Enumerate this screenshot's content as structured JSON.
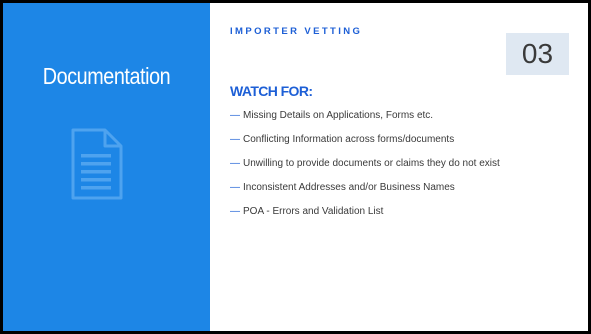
{
  "sidebar": {
    "title": "Documentation",
    "icon": "document-icon",
    "background": "#1d86e6"
  },
  "main": {
    "kicker": "IMPORTER VETTING",
    "number": "03",
    "subhead": "WATCH FOR:",
    "items": [
      "Missing Details on Applications, Forms etc.",
      "Conflicting Information across forms/documents",
      "Unwilling to provide documents or claims they do not exist",
      "Inconsistent Addresses and/or Business Names",
      "POA - Errors and Validation List"
    ],
    "bullet": "—",
    "accent": "#1d5fd6",
    "number_box_color": "#dfe8f2"
  }
}
